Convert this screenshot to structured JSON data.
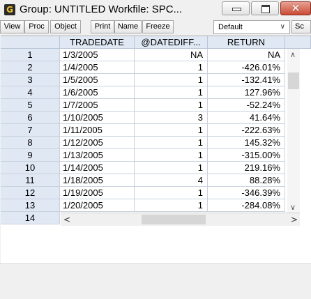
{
  "window": {
    "icon_letter": "G",
    "title": "Group: UNTITLED   Workfile: SPC..."
  },
  "toolbar": {
    "buttons": [
      "View",
      "Proc",
      "Object",
      "Print",
      "Name",
      "Freeze"
    ],
    "dropdown_value": "Default",
    "cut_button": "Sc"
  },
  "table": {
    "columns": [
      "TRADEDATE",
      "@DATEDIFF...",
      "RETURN"
    ],
    "rows": [
      {
        "num": "1",
        "date": "1/3/2005",
        "diff": "NA",
        "ret": "NA"
      },
      {
        "num": "2",
        "date": "1/4/2005",
        "diff": "1",
        "ret": "-426.01%"
      },
      {
        "num": "3",
        "date": "1/5/2005",
        "diff": "1",
        "ret": "-132.41%"
      },
      {
        "num": "4",
        "date": "1/6/2005",
        "diff": "1",
        "ret": "127.96%"
      },
      {
        "num": "5",
        "date": "1/7/2005",
        "diff": "1",
        "ret": "-52.24%"
      },
      {
        "num": "6",
        "date": "1/10/2005",
        "diff": "3",
        "ret": "41.64%"
      },
      {
        "num": "7",
        "date": "1/11/2005",
        "diff": "1",
        "ret": "-222.63%"
      },
      {
        "num": "8",
        "date": "1/12/2005",
        "diff": "1",
        "ret": "145.32%"
      },
      {
        "num": "9",
        "date": "1/13/2005",
        "diff": "1",
        "ret": "-315.00%"
      },
      {
        "num": "10",
        "date": "1/14/2005",
        "diff": "1",
        "ret": "219.16%"
      },
      {
        "num": "11",
        "date": "1/18/2005",
        "diff": "4",
        "ret": "88.28%"
      },
      {
        "num": "12",
        "date": "1/19/2005",
        "diff": "1",
        "ret": "-346.39%"
      },
      {
        "num": "13",
        "date": "1/20/2005",
        "diff": "1",
        "ret": "-284.08%"
      }
    ],
    "partial_row_num": "14"
  },
  "colors": {
    "header_bg": "#dfe8f3",
    "close_button": "#c94c35"
  }
}
